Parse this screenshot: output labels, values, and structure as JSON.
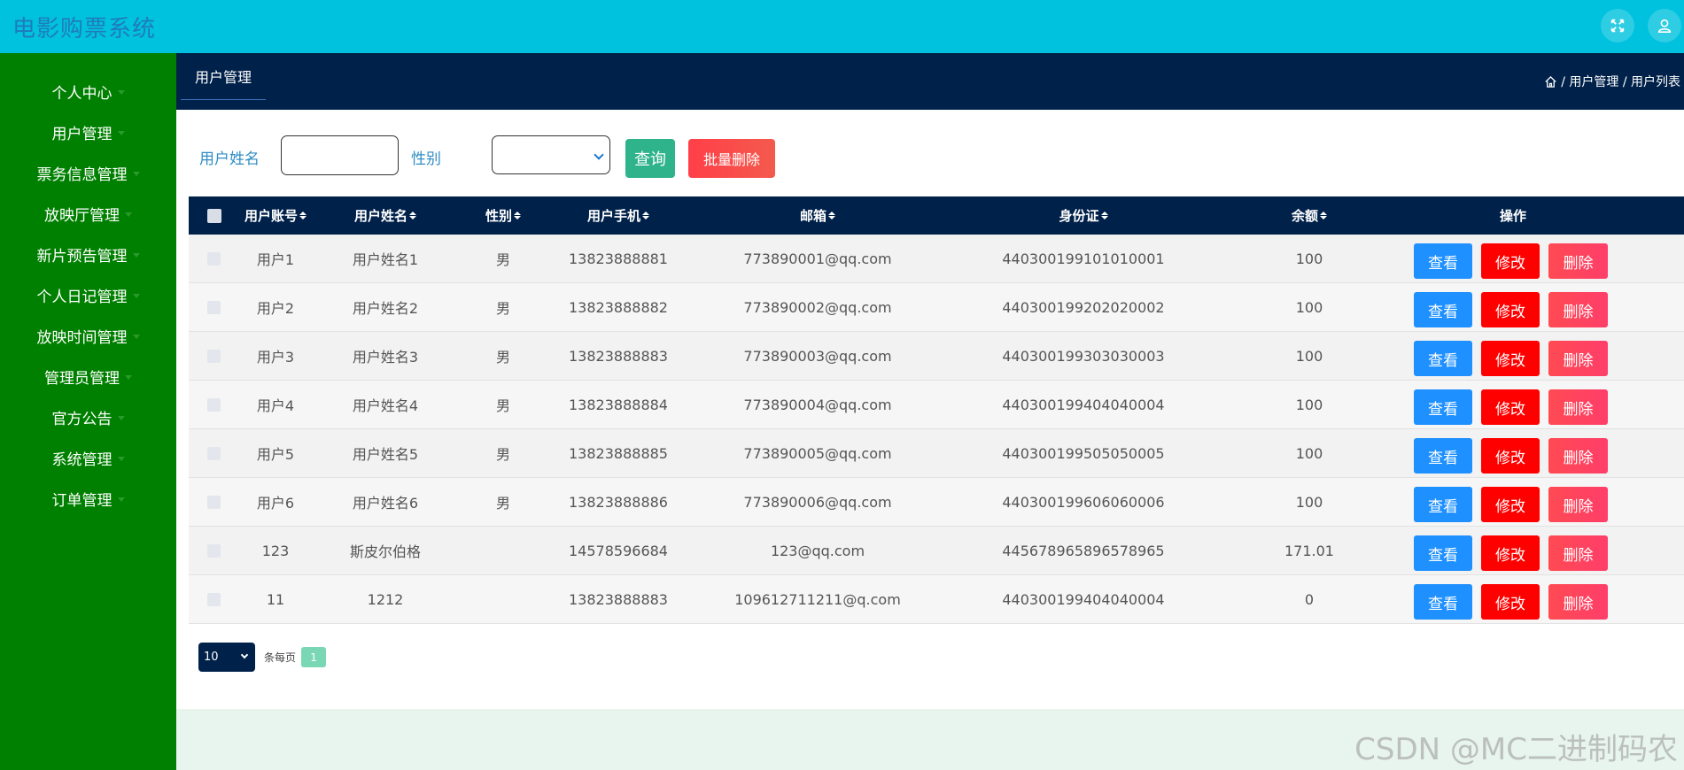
{
  "app": {
    "title": "电影购票系统"
  },
  "sidebar": {
    "items": [
      {
        "label": "个人中心"
      },
      {
        "label": "用户管理"
      },
      {
        "label": "票务信息管理"
      },
      {
        "label": "放映厅管理"
      },
      {
        "label": "新片预告管理"
      },
      {
        "label": "个人日记管理"
      },
      {
        "label": "放映时间管理"
      },
      {
        "label": "管理员管理"
      },
      {
        "label": "官方公告"
      },
      {
        "label": "系统管理"
      },
      {
        "label": "订单管理"
      }
    ]
  },
  "nav": {
    "tab": "用户管理",
    "breadcrumb": "/ 用户管理 / 用户列表"
  },
  "search": {
    "name_label": "用户姓名",
    "name_value": "",
    "gender_label": "性别",
    "gender_value": "",
    "query_label": "查询",
    "batch_delete_label": "批量删除"
  },
  "table": {
    "headers": [
      "用户账号",
      "用户姓名",
      "性别",
      "用户手机",
      "邮箱",
      "身份证",
      "余额",
      "操作"
    ],
    "rows": [
      {
        "account": "用户1",
        "name": "用户姓名1",
        "gender": "男",
        "phone": "13823888881",
        "email": "773890001@qq.com",
        "idcard": "440300199101010001",
        "balance": "100"
      },
      {
        "account": "用户2",
        "name": "用户姓名2",
        "gender": "男",
        "phone": "13823888882",
        "email": "773890002@qq.com",
        "idcard": "440300199202020002",
        "balance": "100"
      },
      {
        "account": "用户3",
        "name": "用户姓名3",
        "gender": "男",
        "phone": "13823888883",
        "email": "773890003@qq.com",
        "idcard": "440300199303030003",
        "balance": "100"
      },
      {
        "account": "用户4",
        "name": "用户姓名4",
        "gender": "男",
        "phone": "13823888884",
        "email": "773890004@qq.com",
        "idcard": "440300199404040004",
        "balance": "100"
      },
      {
        "account": "用户5",
        "name": "用户姓名5",
        "gender": "男",
        "phone": "13823888885",
        "email": "773890005@qq.com",
        "idcard": "440300199505050005",
        "balance": "100"
      },
      {
        "account": "用户6",
        "name": "用户姓名6",
        "gender": "男",
        "phone": "13823888886",
        "email": "773890006@qq.com",
        "idcard": "440300199606060006",
        "balance": "100"
      },
      {
        "account": "123",
        "name": "斯皮尔伯格",
        "gender": "",
        "phone": "14578596684",
        "email": "123@qq.com",
        "idcard": "445678965896578965",
        "balance": "171.01"
      },
      {
        "account": "11",
        "name": "1212",
        "gender": "",
        "phone": "13823888883",
        "email": "109612711211@q.com",
        "idcard": "440300199404040004",
        "balance": "0"
      }
    ],
    "actions": {
      "view": "查看",
      "edit": "修改",
      "delete": "删除"
    }
  },
  "pager": {
    "page_size": "10",
    "per_page_label": "条每页",
    "current_page": "1"
  },
  "watermark": "CSDN @MC二进制码农",
  "colors": {
    "topbar": "#00c2de",
    "sidebar": "#008000",
    "navbar": "#00214a",
    "view": "#1e90ff",
    "edit": "#ff0000",
    "delete": "#ff4a52",
    "query": "#2eb38a"
  }
}
